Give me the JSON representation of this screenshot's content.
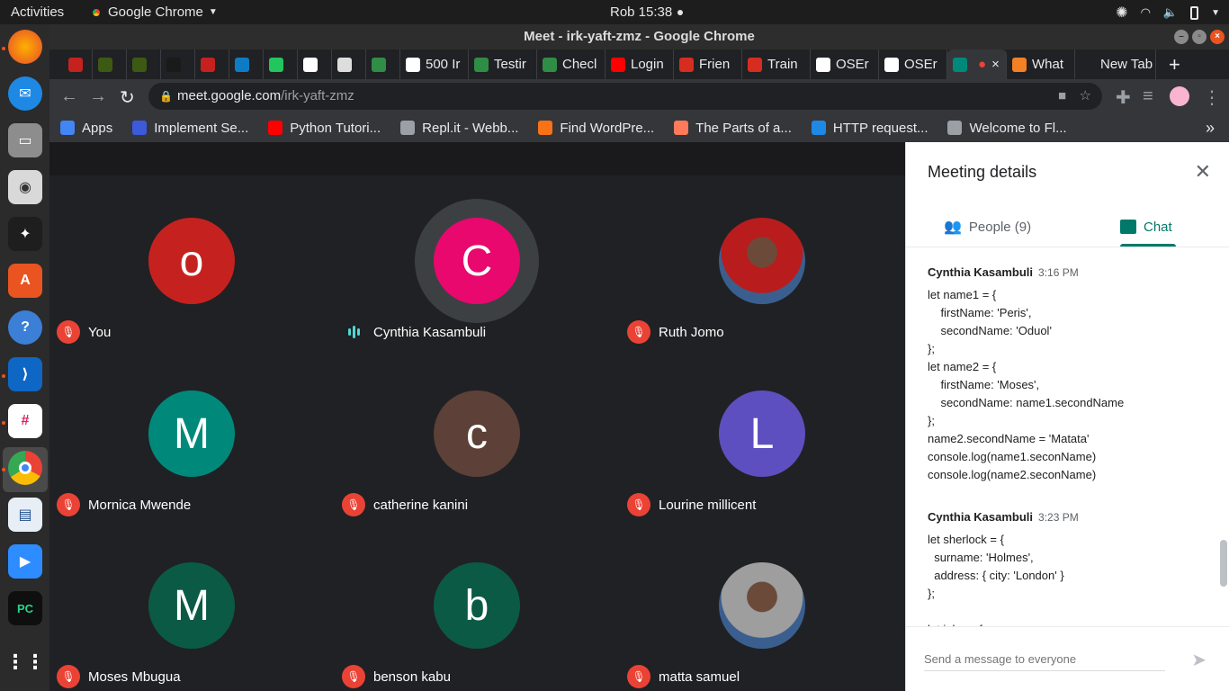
{
  "topbar": {
    "activities": "Activities",
    "app_name": "Google Chrome",
    "clock": "Rob 15:38"
  },
  "window": {
    "title": "Meet - irk-yaft-zmz - Google Chrome"
  },
  "tabs": [
    {
      "label": "",
      "color": "#c5221f"
    },
    {
      "label": "",
      "color": "#3c5a14"
    },
    {
      "label": "",
      "color": "#3c5a14"
    },
    {
      "label": "",
      "color": "#1a1a1a"
    },
    {
      "label": "",
      "color": "#c5221f"
    },
    {
      "label": "",
      "color": "#0e7cc4"
    },
    {
      "label": "",
      "color": "#22c55e"
    },
    {
      "label": "",
      "color": "#ffffff"
    },
    {
      "label": "",
      "color": "#dddddd"
    },
    {
      "label": "",
      "color": "#2f8d46"
    },
    {
      "label": "500 Ir",
      "color": "#ffffff"
    },
    {
      "label": "Testir",
      "color": "#2f8d46"
    },
    {
      "label": "Checl",
      "color": "#2f8d46"
    },
    {
      "label": "Login",
      "color": "#ff0000"
    },
    {
      "label": "Frien",
      "color": "#d62d20"
    },
    {
      "label": "Train",
      "color": "#d62d20"
    },
    {
      "label": "OSEr",
      "color": "#ffffff"
    },
    {
      "label": "OSEr",
      "color": "#ffffff"
    },
    {
      "label": "",
      "color": "#00897b"
    },
    {
      "label": "What",
      "color": "#f48024"
    },
    {
      "label": "New Tab",
      "color": "#202124"
    }
  ],
  "omnibox": {
    "host": "meet.google.com",
    "path": "/irk-yaft-zmz"
  },
  "bookmarks": [
    {
      "label": "Apps",
      "color": "#4285f4"
    },
    {
      "label": "Implement Se...",
      "color": "#3b5bdb"
    },
    {
      "label": "Python Tutori...",
      "color": "#ff0000"
    },
    {
      "label": "Repl.it - Webb...",
      "color": "#9aa0a6"
    },
    {
      "label": "Find WordPre...",
      "color": "#f97316"
    },
    {
      "label": "The Parts of a...",
      "color": "#ff7a59"
    },
    {
      "label": "HTTP request...",
      "color": "#1e88e5"
    },
    {
      "label": "Welcome to Fl...",
      "color": "#9aa0a6"
    }
  ],
  "participants": [
    {
      "name": "You",
      "initial": "o",
      "color": "#c5221f",
      "muted": true
    },
    {
      "name": "Cynthia Kasambuli",
      "initial": "C",
      "color": "#e8086e",
      "muted": false
    },
    {
      "name": "Ruth Jomo",
      "initial": "",
      "color": "#b91c1c",
      "muted": true
    },
    {
      "name": "Mornica Mwende",
      "initial": "M",
      "color": "#00897b",
      "muted": true
    },
    {
      "name": "catherine kanini",
      "initial": "c",
      "color": "#5d4037",
      "muted": true
    },
    {
      "name": "Lourine millicent",
      "initial": "L",
      "color": "#5e4fc0",
      "muted": true
    },
    {
      "name": "Moses Mbugua",
      "initial": "M",
      "color": "#0b5a45",
      "muted": true
    },
    {
      "name": "benson kabu",
      "initial": "b",
      "color": "#0b5a45",
      "muted": true
    },
    {
      "name": "matta samuel",
      "initial": "",
      "color": "#9e9e9e",
      "muted": true
    }
  ],
  "panel": {
    "title": "Meeting details",
    "people_tab": "People (9)",
    "chat_tab": "Chat",
    "send_placeholder": "Send a message to everyone"
  },
  "chat": [
    {
      "sender": "Cynthia Kasambuli",
      "time": "3:16 PM",
      "lines": [
        "let name1 = {",
        "    firstName: 'Peris',",
        "    secondName: 'Oduol'",
        "};",
        "let name2 = {",
        "    firstName: 'Moses',",
        "    secondName: name1.secondName",
        "};",
        "name2.secondName = 'Matata'",
        "console.log(name1.seconName)",
        "console.log(name2.seconName)"
      ]
    },
    {
      "sender": "Cynthia Kasambuli",
      "time": "3:23 PM",
      "lines": [
        "let sherlock = {",
        "  surname: 'Holmes',",
        "  address: { city: 'London' }",
        "};",
        "",
        "let john = {"
      ]
    }
  ]
}
